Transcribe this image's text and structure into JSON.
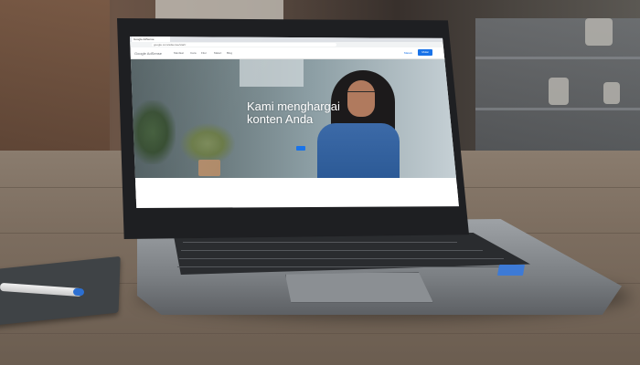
{
  "browser": {
    "tab_title": "Google AdSense",
    "address": "google.com/adsense/start/"
  },
  "site": {
    "logo": "Google AdSense",
    "nav": [
      "Manfaat",
      "Cara",
      "Fitur",
      "Materi",
      "Blog"
    ],
    "login": "Masuk",
    "cta": "Mulai"
  },
  "hero": {
    "title_line1": "Kami menghargai",
    "title_line2": "konten Anda",
    "subtitle": "",
    "button": ""
  },
  "cookie_bar": {
    "text": "",
    "buttons": [
      "",
      ""
    ]
  },
  "colors": {
    "accent": "#1a73e8",
    "laptop_body": "#7b7f83",
    "table_wood": "#7d6e60"
  }
}
